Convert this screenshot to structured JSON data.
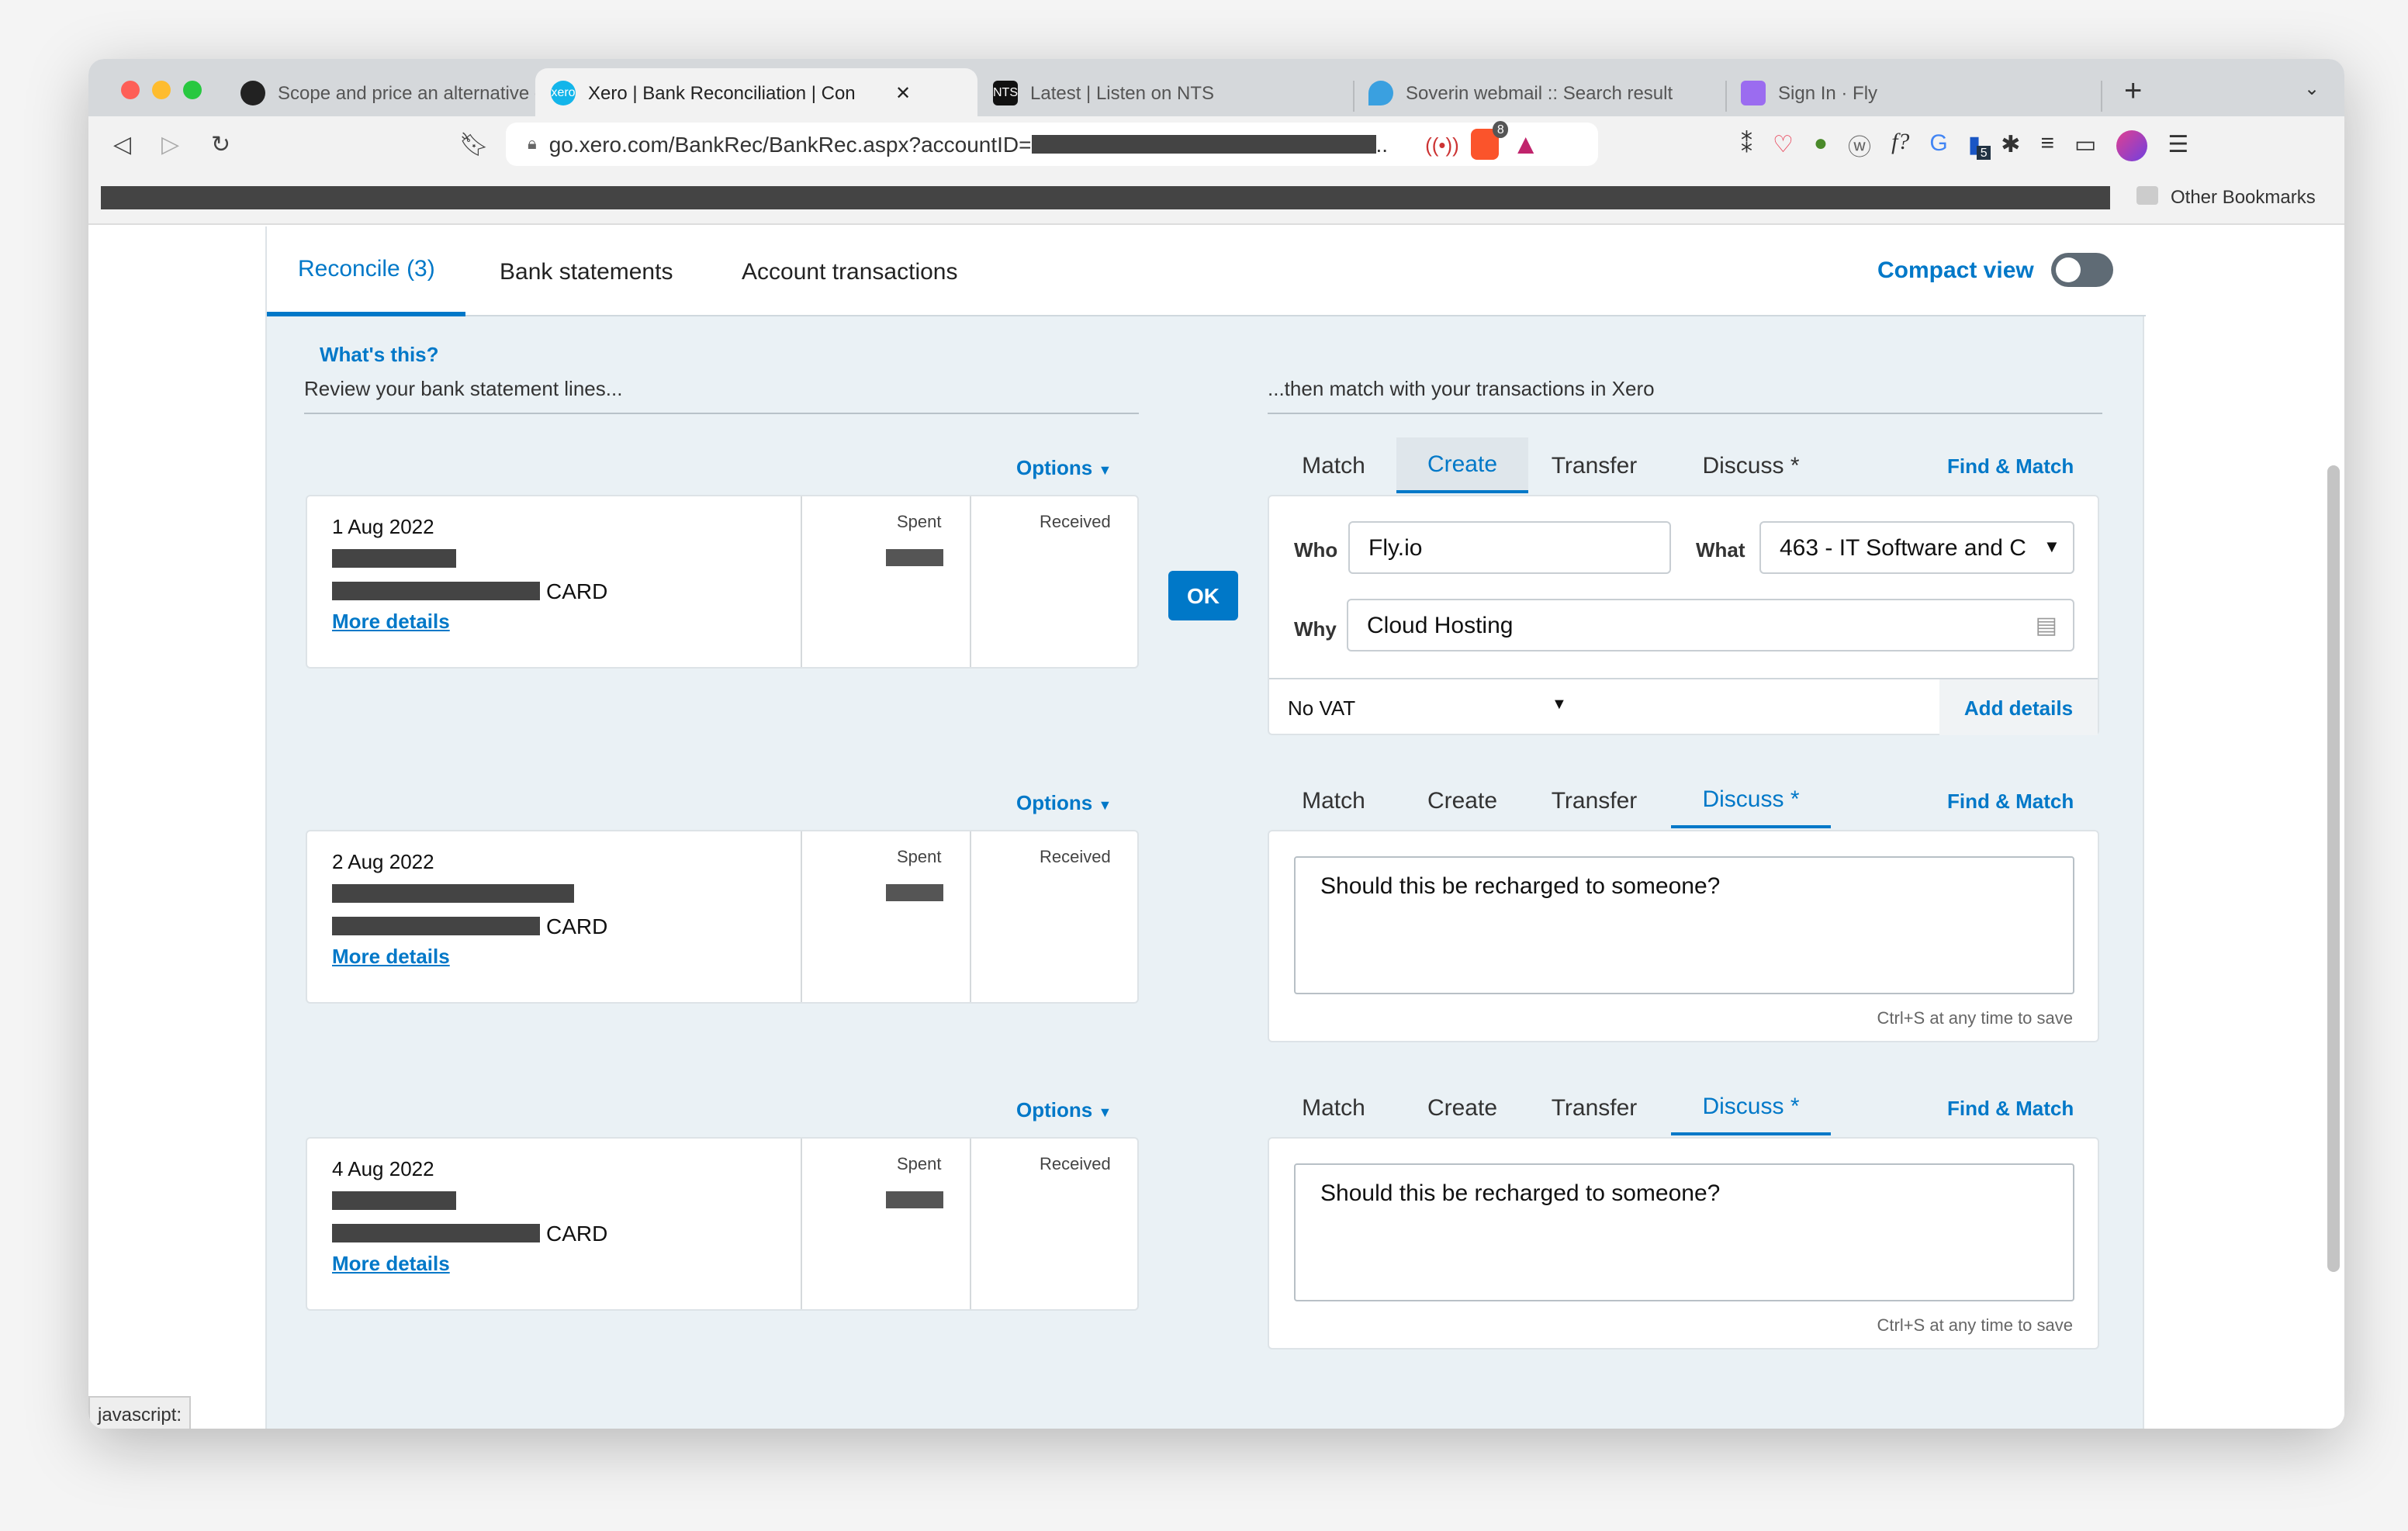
{
  "browser": {
    "tabs": [
      {
        "title": "Scope and price an alternative calen",
        "icon": "github-icon"
      },
      {
        "title": "Xero | Bank Reconciliation | Con",
        "icon": "xero-icon",
        "active": true
      },
      {
        "title": "Latest | Listen on NTS",
        "icon": "nts-icon"
      },
      {
        "title": "Soverin webmail :: Search result",
        "icon": "soverin-icon"
      },
      {
        "title": "Sign In · Fly",
        "icon": "fly-icon"
      }
    ],
    "url": "go.xero.com/BankRec/BankRec.aspx?accountID=",
    "url_suffix": "..",
    "brave_badge": "8",
    "ext_badge": "5",
    "other_bookmarks": "Other Bookmarks",
    "status_text": "javascript:"
  },
  "header": {
    "tabs": [
      "Reconcile (3)",
      "Bank statements",
      "Account transactions"
    ],
    "compact_view_label": "Compact view",
    "compact_view_on": false
  },
  "intro": {
    "whats_this": "What's this?",
    "left_caption": "Review your bank statement lines...",
    "right_caption": "...then match with your transactions in Xero"
  },
  "labels": {
    "options": "Options",
    "spent": "Spent",
    "received": "Received",
    "card": "CARD",
    "more_details": "More details",
    "ok": "OK",
    "tabs": [
      "Match",
      "Create",
      "Transfer",
      "Discuss *"
    ],
    "find_match": "Find & Match",
    "who": "Who",
    "what": "What",
    "why": "Why",
    "add_details": "Add details",
    "save_hint": "Ctrl+S at any time to save"
  },
  "rows": [
    {
      "date": "1 Aug 2022",
      "active_tab": "Create",
      "who": "Fly.io",
      "what": "463 - IT Software and C",
      "why": "Cloud Hosting",
      "vat": "No VAT"
    },
    {
      "date": "2 Aug 2022",
      "active_tab": "Discuss *",
      "comment": "Should this be recharged to someone?"
    },
    {
      "date": "4 Aug 2022",
      "active_tab": "Discuss *",
      "comment": "Should this be recharged to someone?"
    }
  ],
  "colors": {
    "accent": "#0078c8",
    "page_bg": "#eaf1f5"
  }
}
